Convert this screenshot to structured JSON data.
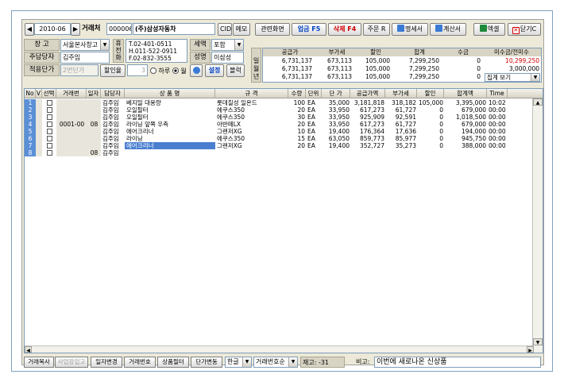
{
  "top": {
    "date": "2010-06",
    "nav_prev": "◀",
    "nav_next": "▶",
    "customer_label": "거래처",
    "customer_code": "000006",
    "customer_name": "(주)삼성자동차",
    "cid_btn": "CID",
    "memo_btn": "메모",
    "related_btn": "관련화면",
    "business_btn": "업금 F5",
    "delete_btn": "삭제 F4",
    "order_btn": "주문 R",
    "statement_btn": "명세서",
    "invoice_btn": "계산서",
    "excel_btn": "엑셀",
    "close_btn": "닫기C"
  },
  "form": {
    "warehouse_label": "창 고",
    "warehouse_value": "서울본사창고",
    "manager_label": "주담당자",
    "manager_value": "김주임",
    "apply_price_label": "적용단가",
    "apply_price_value": "2번단가",
    "discount_label": "할인율",
    "discount_value": "3",
    "period_label": "하루",
    "period_month": "월",
    "phone_label_1": "휴",
    "phone_label_2": "전",
    "phone_label_3": "화",
    "tel": "T.02-401-0511",
    "hp": "H.011-522-0911",
    "fax": "F.02-832-3555",
    "tax_label": "세액",
    "tax_value": "포함",
    "name_label": "성명",
    "name_value": "이삼성",
    "settings_btn": "설정",
    "block_btn": "블럭"
  },
  "summary": {
    "headers": [
      "공급가",
      "부가세",
      "할인",
      "합계",
      "수금",
      "미수금/전미수"
    ],
    "rows": [
      {
        "label": "일",
        "values": [
          "6,731,137",
          "673,113",
          "105,000",
          "7,299,250",
          "0",
          "10,299,250"
        ]
      },
      {
        "label": "월",
        "values": [
          "6,731,137",
          "673,113",
          "105,000",
          "7,299,250",
          "0",
          "3,000,000"
        ]
      },
      {
        "label": "년",
        "values": [
          "6,731,137",
          "673,113",
          "105,000",
          "7,299,250",
          "0",
          "집계 보기"
        ]
      }
    ],
    "overdue_color": "#d00000"
  },
  "grid": {
    "headers": [
      "No",
      "V",
      "선택",
      "거래번",
      "일자",
      "담당자",
      "상 품 명",
      "규 격",
      "수량",
      "단위",
      "단 가",
      "공급가액",
      "부가세",
      "할인",
      "합계액",
      "Time"
    ],
    "rows": [
      {
        "no": "1",
        "sel": true,
        "txn": "",
        "day": "",
        "mgr": "김주임",
        "product": "베지밀 대용량",
        "spec": "롯데칠성 일온드",
        "qty": "100",
        "unit": "EA",
        "price": "35,000",
        "supply": "3,181,818",
        "vat": "318,182",
        "disc": "105,000",
        "total": "3,395,000",
        "time": "10:02"
      },
      {
        "no": "2",
        "sel": true,
        "txn": "",
        "day": "",
        "mgr": "김주임",
        "product": "오일필터",
        "spec": "에쿠스350",
        "qty": "20",
        "unit": "EA",
        "price": "33,950",
        "supply": "617,273",
        "vat": "61,727",
        "disc": "0",
        "total": "679,000",
        "time": "00:00"
      },
      {
        "no": "3",
        "sel": true,
        "txn": "",
        "day": "",
        "mgr": "김주임",
        "product": "오일필터",
        "spec": "에쿠스350",
        "qty": "30",
        "unit": "EA",
        "price": "33,950",
        "supply": "925,909",
        "vat": "92,591",
        "disc": "0",
        "total": "1,018,500",
        "time": "00:00"
      },
      {
        "no": "4",
        "sel": true,
        "txn": "0001-00",
        "day": "08",
        "mgr": "김주임",
        "product": "라이닝 앞쪽 우측",
        "spec": "아반떼LX",
        "qty": "20",
        "unit": "EA",
        "price": "33,950",
        "supply": "617,273",
        "vat": "61,727",
        "disc": "0",
        "total": "679,000",
        "time": "00:00"
      },
      {
        "no": "5",
        "sel": true,
        "txn": "",
        "day": "",
        "mgr": "김주임",
        "product": "에어크리너",
        "spec": "그랜저XG",
        "qty": "10",
        "unit": "EA",
        "price": "19,400",
        "supply": "176,364",
        "vat": "17,636",
        "disc": "0",
        "total": "194,000",
        "time": "00:00"
      },
      {
        "no": "6",
        "sel": true,
        "txn": "",
        "day": "",
        "mgr": "김주임",
        "product": "라이닝",
        "spec": "에쿠스350",
        "qty": "15",
        "unit": "EA",
        "price": "63,050",
        "supply": "859,773",
        "vat": "85,977",
        "disc": "0",
        "total": "945,750",
        "time": "00:00"
      },
      {
        "no": "7",
        "sel": true,
        "txn": "",
        "day": "",
        "mgr": "김주임",
        "product": "에어크리너",
        "spec": "그랜저XG",
        "qty": "20",
        "unit": "EA",
        "price": "19,400",
        "supply": "352,727",
        "vat": "35,273",
        "disc": "0",
        "total": "388,000",
        "time": "00:00"
      },
      {
        "no": "8",
        "sel": true,
        "txn": "",
        "day": "08",
        "mgr": "김주임",
        "product": "",
        "spec": "",
        "qty": "",
        "unit": "",
        "price": "",
        "supply": "",
        "vat": "",
        "disc": "",
        "total": "",
        "time": ""
      }
    ],
    "selected_row_color": "#4a7fd0"
  },
  "bottom": {
    "copy_btn": "거래복사",
    "biz_btn": "사업장입고",
    "date_change_btn": "일자변경",
    "txn_no_btn": "거래번호",
    "product_filter_btn": "상품필터",
    "price_change_btn": "단가변동",
    "lang_value": "한글",
    "order_value": "거래번호순",
    "stock_label": "재고: -31",
    "note_label": "비고:",
    "note_value": "이번에 새로나온 신상품"
  }
}
